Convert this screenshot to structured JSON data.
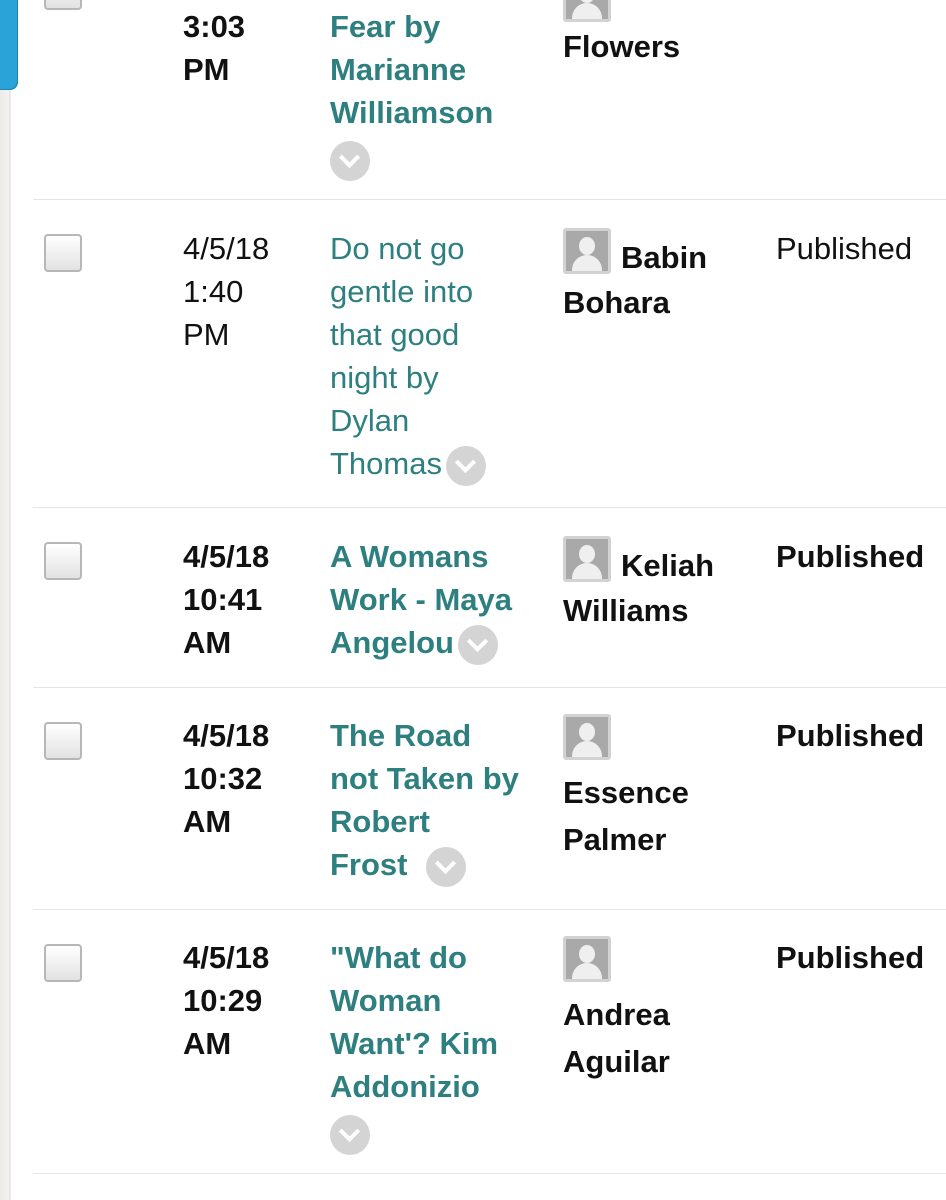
{
  "rows": [
    {
      "date": [
        "3:03",
        "PM"
      ],
      "title": [
        "Fear by",
        "Marianne",
        "Williamson"
      ],
      "author": [
        "",
        "Flowers"
      ],
      "status": ""
    },
    {
      "date": [
        "4/5/18",
        "1:40",
        "PM"
      ],
      "title": [
        "Do not go",
        "gentle into",
        "that good",
        "night by",
        "Dylan",
        "Thomas"
      ],
      "author": [
        "Babin",
        "Bohara"
      ],
      "status": "Published"
    },
    {
      "date": [
        "4/5/18",
        "10:41",
        "AM"
      ],
      "title": [
        "A Womans",
        "Work - Maya",
        "Angelou"
      ],
      "author": [
        "Keliah",
        "Williams"
      ],
      "status": "Published"
    },
    {
      "date": [
        "4/5/18",
        "10:32",
        "AM"
      ],
      "title": [
        "The Road",
        "not Taken by",
        "Robert",
        "Frost"
      ],
      "author": [
        "Essence",
        "Palmer"
      ],
      "status": "Published"
    },
    {
      "date": [
        "4/5/18",
        "10:29",
        "AM"
      ],
      "title": [
        "\"What do",
        "Woman",
        "Want'? Kim",
        "Addonizio"
      ],
      "author": [
        "Andrea",
        "Aguilar"
      ],
      "status": "Published"
    }
  ],
  "icons": {
    "row_actions": "chevron-down-icon",
    "author_avatar": "user-avatar-icon"
  },
  "colors": {
    "title_link": "#2e7f7f",
    "left_tab": "#2aa3d8",
    "chevron_bg": "#d4d4d4"
  }
}
